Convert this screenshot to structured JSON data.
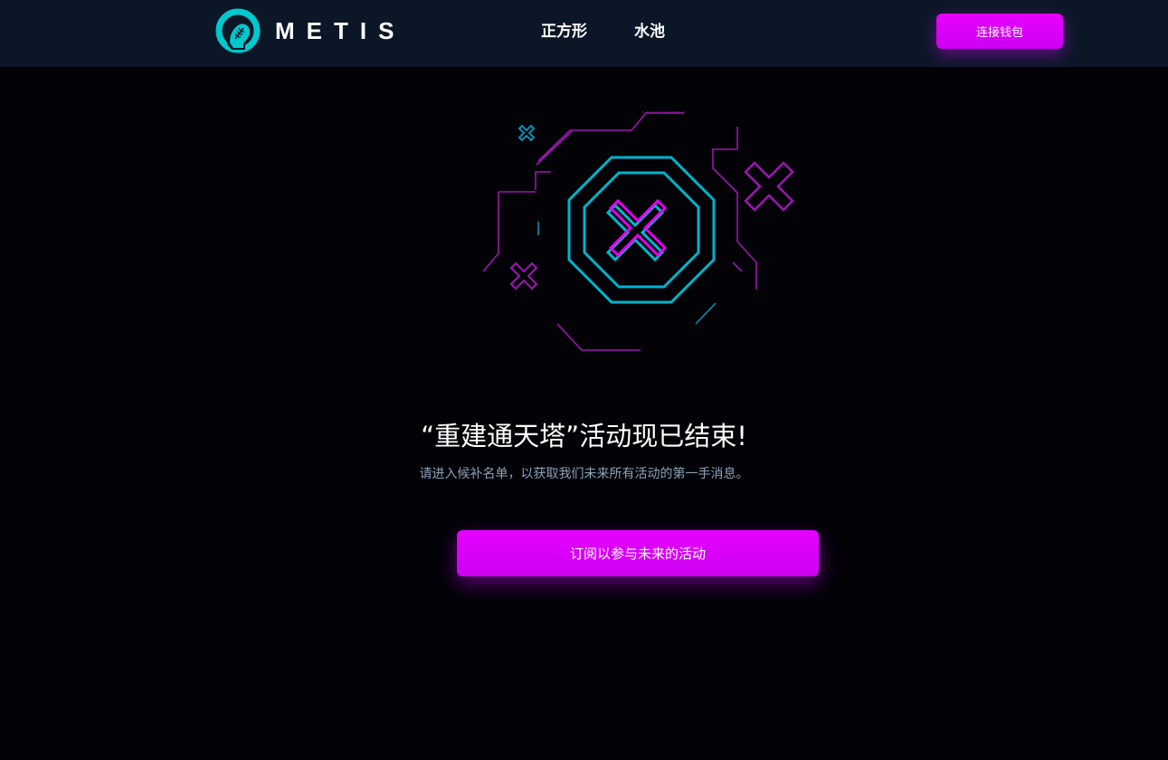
{
  "header": {
    "logo_text": "METIS",
    "logo_icon": "metis-head-logo-icon",
    "nav": [
      {
        "label": "正方形"
      },
      {
        "label": "水池"
      }
    ],
    "connect_wallet_label": "连接钱包"
  },
  "main": {
    "illustration_icon": "error-x-octagon-icon",
    "headline": "“重建通天塔”活动现已结束!",
    "subtext": "请进入候补名单，以获取我们未来所有活动的第一手消息。",
    "subscribe_label": "订阅以参与未来的活动"
  },
  "colors": {
    "background": "#020207",
    "header_bg": "#0b1726",
    "accent_magenta": "#e600ff",
    "accent_cyan": "#00c2d6",
    "subtext": "#8aa2b8"
  }
}
